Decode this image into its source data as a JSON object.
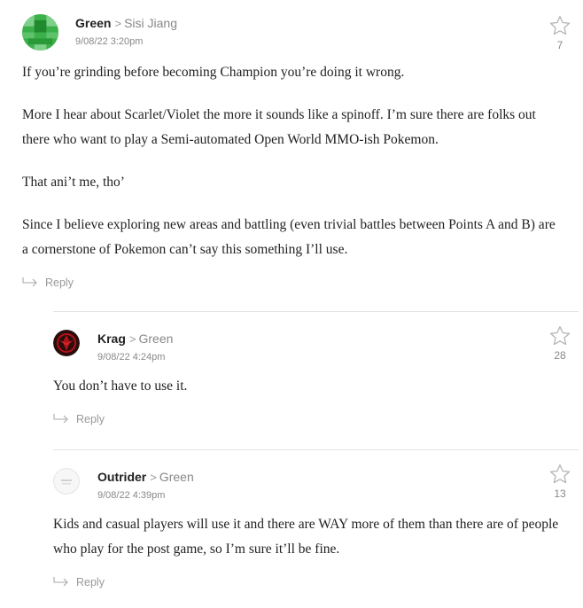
{
  "comments": [
    {
      "author": "Green",
      "in_reply_to": "Sisi Jiang",
      "timestamp": "9/08/22 3:20pm",
      "star_count": "7",
      "avatar_icon": "pixel-avatar-icon",
      "paragraphs": [
        "If you’re grinding before becoming Champion you’re doing it wrong.",
        "More I hear about Scarlet/Violet the more it sounds like a spinoff. I’m sure there are folks out there who want to play a Semi-automated Open World MMO-ish Pokemon.",
        "That ani’t me, tho’",
        "Since I believe exploring new areas and battling (even trivial battles between Points A and B) are a cornerstone of Pokemon can’t say this something I’ll use."
      ],
      "reply_label": "Reply"
    },
    {
      "author": "Krag",
      "in_reply_to": "Green",
      "timestamp": "9/08/22 4:24pm",
      "star_count": "28",
      "avatar_icon": "red-emblem-avatar-icon",
      "paragraphs": [
        "You don’t have to use it."
      ],
      "reply_label": "Reply"
    },
    {
      "author": "Outrider",
      "in_reply_to": "Green",
      "timestamp": "9/08/22 4:39pm",
      "star_count": "13",
      "avatar_icon": "default-avatar-icon",
      "paragraphs": [
        "Kids and casual players will use it and there are WAY more of them than there are of people who play for the post game, so I’m sure it’ll be fine."
      ],
      "reply_label": "Reply"
    }
  ],
  "ui": {
    "reply_separator": ">"
  },
  "colors": {
    "avatar_green": "#3cb04a",
    "krag_red": "#b3121a"
  }
}
